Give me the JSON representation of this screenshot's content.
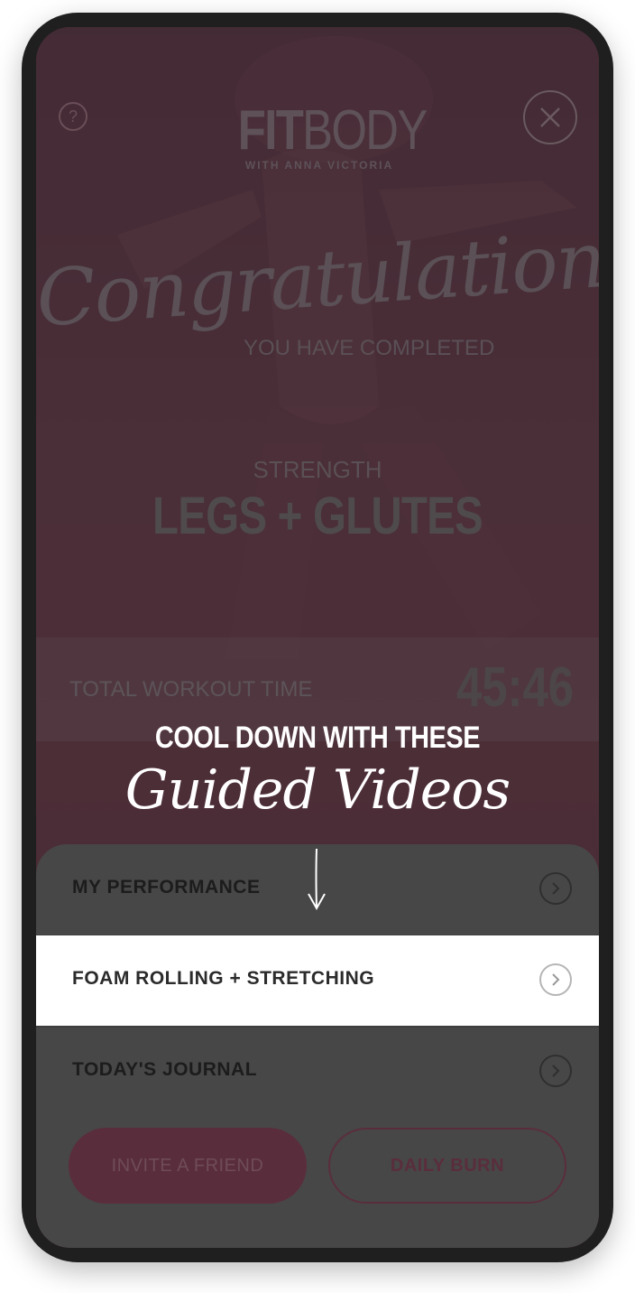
{
  "header": {
    "help_icon": "question-icon",
    "close_icon": "close-icon",
    "logo_primary_bold": "FIT",
    "logo_primary_light": "BODY",
    "logo_secondary": "WITH ANNA VICTORIA"
  },
  "summary": {
    "headline": "Congratulations!",
    "subheadline": "YOU HAVE COMPLETED",
    "category": "STRENGTH",
    "workout_name": "LEGS + GLUTES",
    "time_label": "TOTAL WORKOUT TIME",
    "time_value": "45:46"
  },
  "callout": {
    "line1": "COOL DOWN WITH THESE",
    "line2": "Guided Videos",
    "arrow_icon": "arrow-down-icon"
  },
  "menu": {
    "items": [
      {
        "label": "MY PERFORMANCE",
        "icon": "chevron-right-icon",
        "highlighted": false
      },
      {
        "label": "FOAM ROLLING + STRETCHING",
        "icon": "chevron-right-icon",
        "highlighted": true
      },
      {
        "label": "TODAY'S JOURNAL",
        "icon": "chevron-right-icon",
        "highlighted": false
      }
    ]
  },
  "actions": {
    "invite_label": "INVITE A FRIEND",
    "daily_burn_label": "DAILY BURN"
  },
  "colors": {
    "brand": "#a93d5e",
    "overlay": "#474747",
    "highlight": "#ffffff"
  }
}
